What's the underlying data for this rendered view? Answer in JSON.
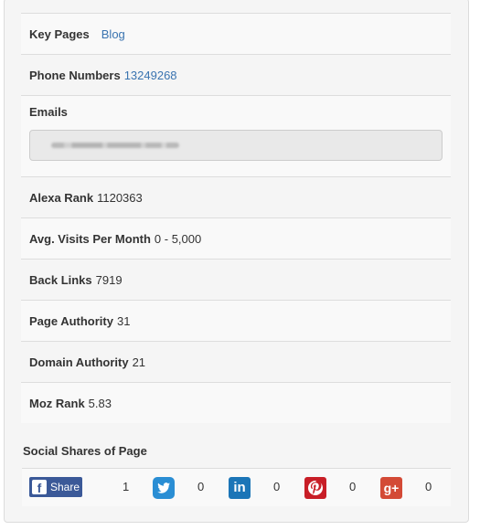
{
  "rows": {
    "key_pages": {
      "label": "Key Pages",
      "link": "Blog"
    },
    "phone_numbers": {
      "label": "Phone Numbers",
      "value": "13249268"
    },
    "emails": {
      "label": "Emails"
    },
    "alexa_rank": {
      "label": "Alexa Rank",
      "value": "1120363"
    },
    "avg_visits": {
      "label": "Avg. Visits Per Month",
      "value": "0 - 5,000"
    },
    "back_links": {
      "label": "Back Links",
      "value": "7919"
    },
    "page_authority": {
      "label": "Page Authority",
      "value": "31"
    },
    "domain_authority": {
      "label": "Domain Authority",
      "value": "21"
    },
    "moz_rank": {
      "label": "Moz Rank",
      "value": "5.83"
    }
  },
  "social": {
    "title": "Social Shares of Page",
    "facebook": {
      "label": "Share",
      "count": "1",
      "icon": "facebook-icon"
    },
    "twitter": {
      "count": "0",
      "icon": "twitter-icon"
    },
    "linkedin": {
      "count": "0",
      "icon": "linkedin-icon"
    },
    "pinterest": {
      "count": "0",
      "icon": "pinterest-icon"
    },
    "googleplus": {
      "count": "0",
      "icon": "google-plus-icon"
    }
  },
  "colors": {
    "link": "#3a74b0",
    "facebook": "#3b5998",
    "twitter": "#2a8ed4",
    "linkedin": "#1b75b7",
    "pinterest": "#c81e27",
    "googleplus": "#d34a36"
  }
}
